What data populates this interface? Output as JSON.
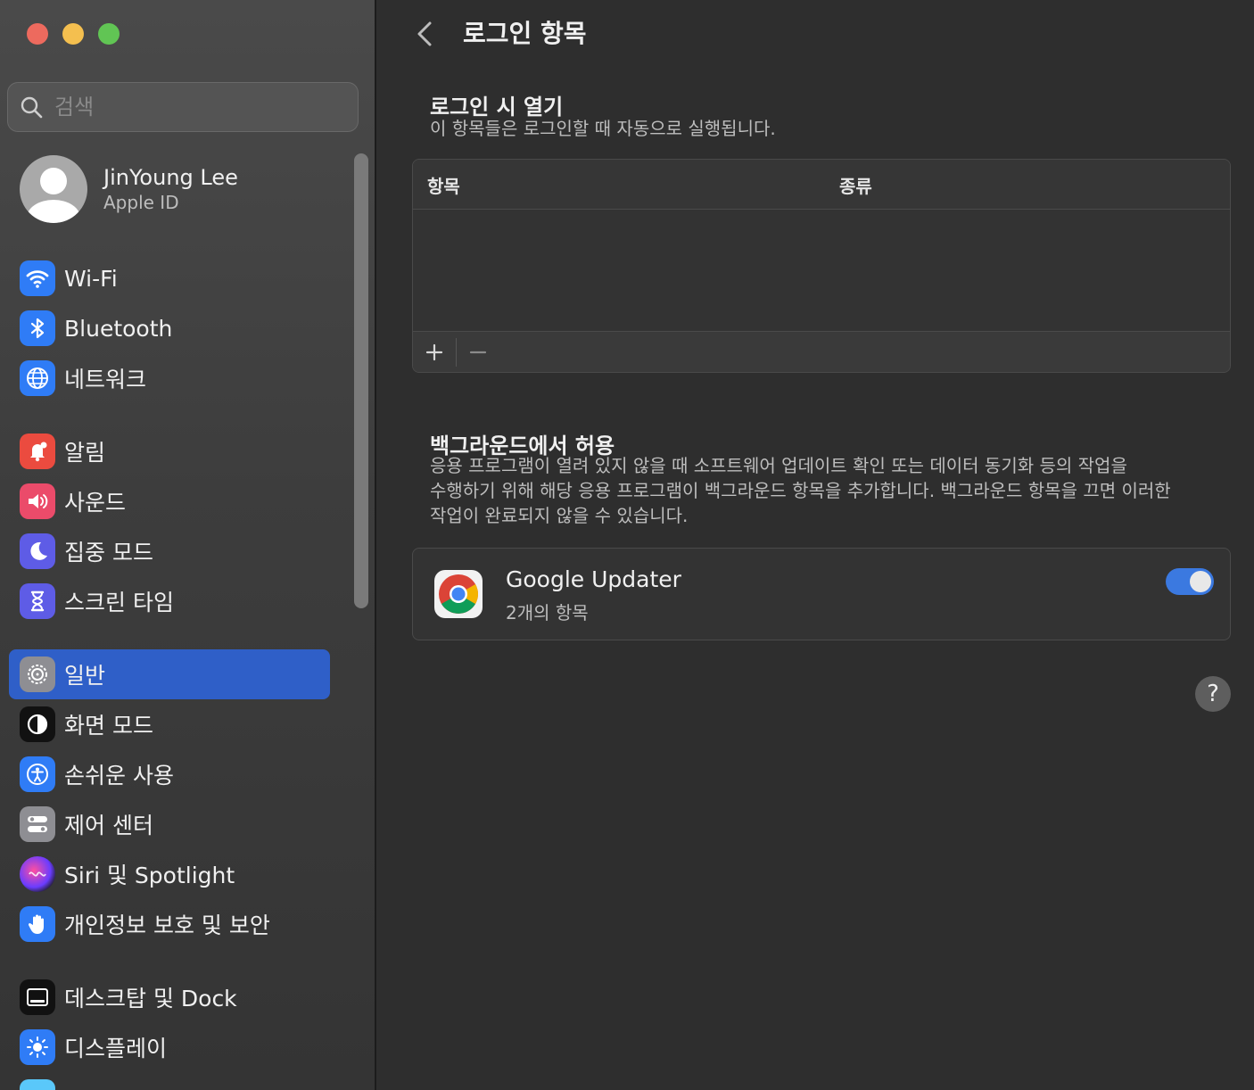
{
  "sidebar": {
    "search": {
      "placeholder": "검색"
    },
    "profile": {
      "name": "JinYoung Lee",
      "subtitle": "Apple ID"
    },
    "items": [
      {
        "label": "Wi-Fi",
        "icon": "wifi-icon"
      },
      {
        "label": "Bluetooth",
        "icon": "bluetooth-icon"
      },
      {
        "label": "네트워크",
        "icon": "globe-icon"
      },
      {
        "label": "알림",
        "icon": "bell-icon"
      },
      {
        "label": "사운드",
        "icon": "speaker-icon"
      },
      {
        "label": "집중 모드",
        "icon": "moon-icon"
      },
      {
        "label": "스크린 타임",
        "icon": "hourglass-icon"
      },
      {
        "label": "일반",
        "icon": "gear-icon"
      },
      {
        "label": "화면 모드",
        "icon": "appearance-icon"
      },
      {
        "label": "손쉬운 사용",
        "icon": "accessibility-icon"
      },
      {
        "label": "제어 센터",
        "icon": "control-center-icon"
      },
      {
        "label": "Siri 및 Spotlight",
        "icon": "siri-icon"
      },
      {
        "label": "개인정보 보호 및 보안",
        "icon": "hand-icon"
      },
      {
        "label": "데스크탑 및 Dock",
        "icon": "dock-icon"
      },
      {
        "label": "디스플레이",
        "icon": "sun-icon"
      }
    ],
    "selected_label": "일반"
  },
  "main": {
    "title": "로그인 항목",
    "login_section": {
      "title": "로그인 시 열기",
      "description": "이 항목들은 로그인할 때 자동으로 실행됩니다.",
      "columns": [
        "항목",
        "종류"
      ],
      "add_label": "+",
      "remove_label": "−"
    },
    "background_section": {
      "title": "백그라운드에서 허용",
      "description_lines": [
        "응용 프로그램이 열려 있지 않을 때 소프트웨어 업데이트 확인 또는 데이터 동기화 등의 작업을",
        "수행하기 위해 해당 응용 프로그램이 백그라운드 항목을 추가합니다. 백그라운드 항목을 끄면 이러한",
        "작업이 완료되지 않을 수 있습니다."
      ],
      "items": [
        {
          "name": "Google Updater",
          "subtitle": "2개의 항목",
          "enabled": true,
          "icon": "chrome-icon"
        }
      ]
    },
    "help_label": "?"
  },
  "colors": {
    "accent": "#2f5fc8",
    "toggle_on": "#3b79e0",
    "close": "#ed6a5e",
    "minimize": "#f4bf4f",
    "zoom": "#61c554"
  }
}
